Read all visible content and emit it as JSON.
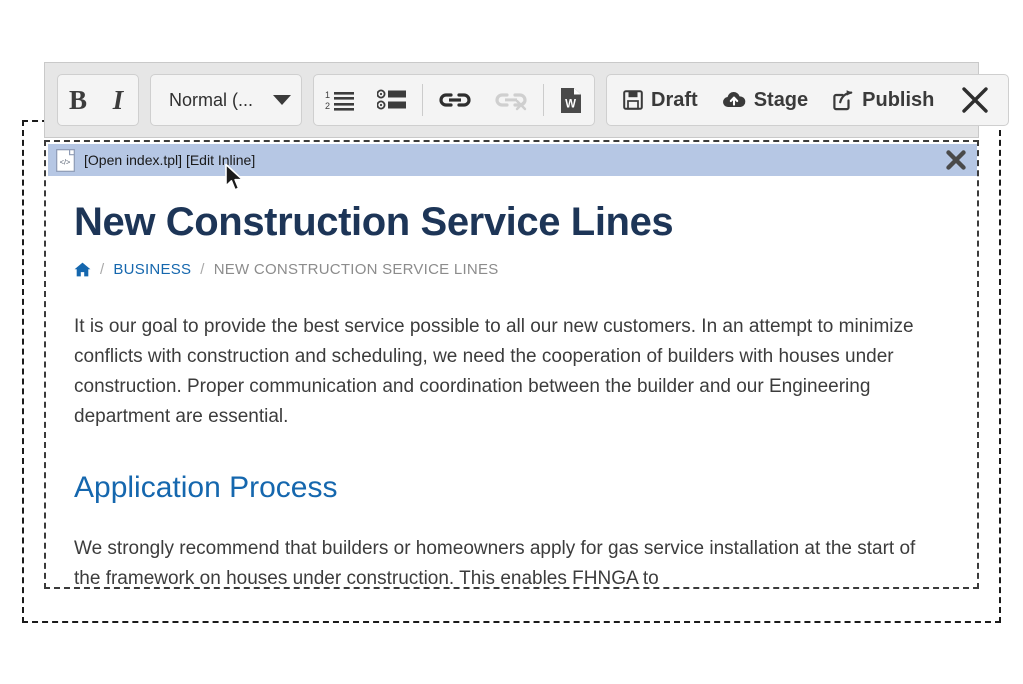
{
  "toolbar": {
    "bold_label": "B",
    "italic_label": "I",
    "format_label": "Normal (...",
    "ordered_list_title": "Numbered List",
    "bullet_list_title": "Bulleted List",
    "link_title": "Insert Link",
    "unlink_title": "Remove Link",
    "paste_word_title": "Paste from Word",
    "paste_word_glyph": "W",
    "draft_label": "Draft",
    "stage_label": "Stage",
    "publish_label": "Publish",
    "close_title": "Close Editor"
  },
  "inline_bar": {
    "text": "[Open index.tpl] [Edit Inline]",
    "icon_glyph": "</>",
    "background_color": "#b6c7e4"
  },
  "page": {
    "title": "New Construction Service Lines",
    "title_color": "#1d3557",
    "breadcrumb": {
      "home_icon": "home-icon",
      "separator": "/",
      "parent": "BUSINESS",
      "current": "NEW CONSTRUCTION SERVICE LINES",
      "link_color": "#1567ae"
    },
    "paragraph_1": "It is our goal to provide the best service possible to all our new customers. In an attempt to minimize conflicts with construction and scheduling, we need the cooperation of builders with houses under construction. Proper communication and coordination between the builder and our Engineering department are essential.",
    "section_heading": "Application Process",
    "section_heading_color": "#1567ae",
    "paragraph_2": "We strongly recommend that builders or homeowners apply for gas service installation at the start of the framework on houses under construction. This enables FHNGA to"
  }
}
